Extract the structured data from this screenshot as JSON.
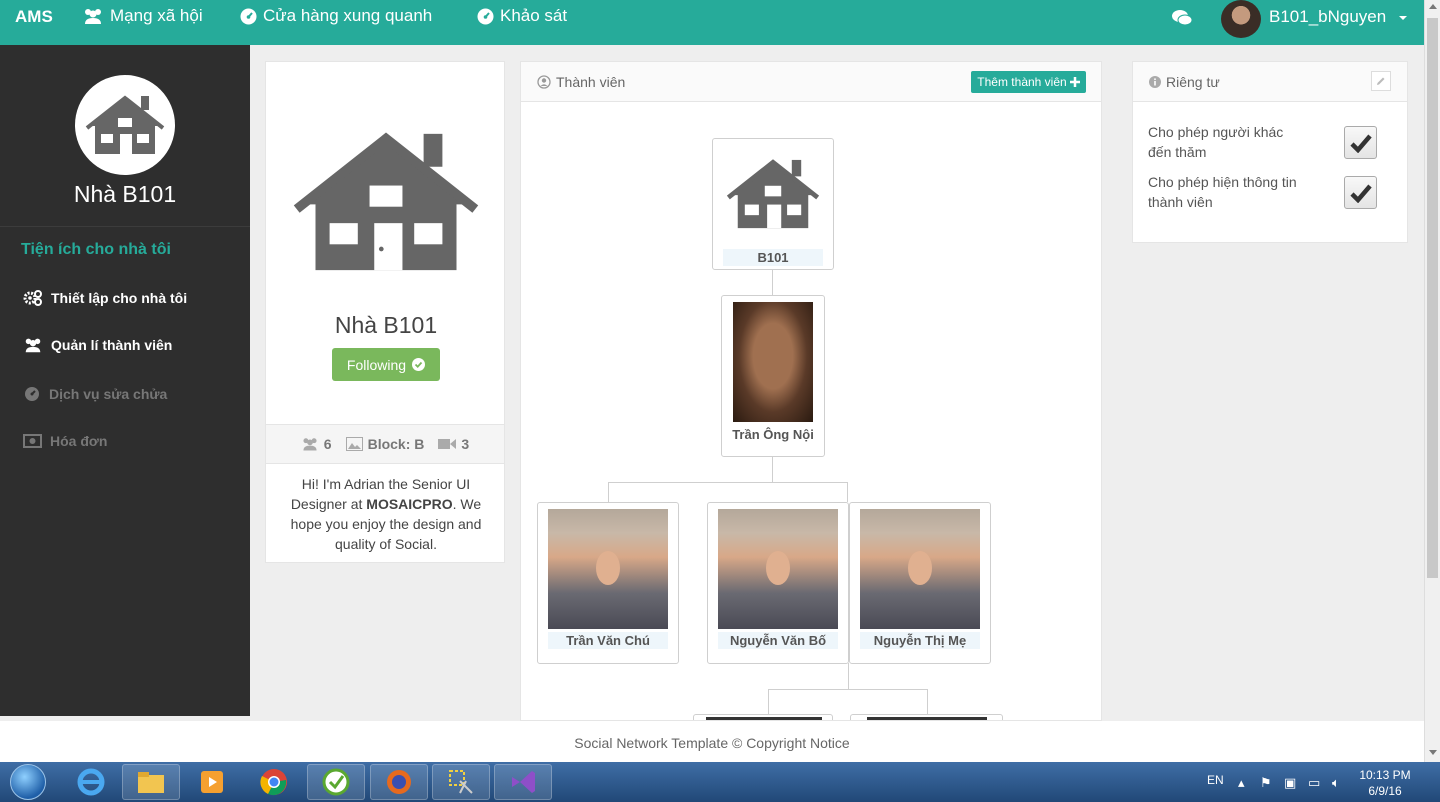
{
  "topnav": {
    "brand": "AMS",
    "items": [
      "Mạng xã hội",
      "Cửa hàng xung quanh",
      "Khảo sát"
    ],
    "username": "B101_bNguyen"
  },
  "sidebar": {
    "house_name": "Nhà B101",
    "section_title": "Tiện ích cho nhà tôi",
    "menu": [
      {
        "label": "Thiết lập cho nhà tôi",
        "icon": "gears-icon",
        "enabled": true
      },
      {
        "label": "Quản lí thành viên",
        "icon": "users-icon",
        "enabled": true
      },
      {
        "label": "Dịch vụ sửa chửa",
        "icon": "wrench-icon",
        "enabled": false
      },
      {
        "label": "Hóa đơn",
        "icon": "money-icon",
        "enabled": false
      }
    ]
  },
  "profile": {
    "name": "Nhà B101",
    "follow_label": "Following",
    "members_count": "6",
    "block": "Block: B",
    "video_count": "3",
    "bio_part1": "Hi! I'm Adrian the Senior UI Designer at ",
    "bio_brand": "MOSAICPRO",
    "bio_part2": ". We hope you enjoy the design and quality of Social."
  },
  "members": {
    "title": "Thành viên",
    "add_label": "Thêm thành viên",
    "tree": {
      "root": "B101",
      "grandparent": "Trần Ông Nội",
      "children": [
        "Trần Văn Chú",
        "Nguyễn Văn Bố",
        "Nguyễn Thị Mẹ"
      ]
    }
  },
  "privacy": {
    "title": "Riêng tư",
    "options": [
      {
        "label": "Cho phép người khác đến thăm",
        "checked": true
      },
      {
        "label": "Cho phép hiện thông tin thành viên",
        "checked": true
      }
    ]
  },
  "footer": {
    "text": "Social Network Template © Copyright Notice"
  },
  "taskbar": {
    "lang": "EN",
    "time": "10:13 PM",
    "date": "6/9/16"
  },
  "colors": {
    "accent": "#26ab9a",
    "sidebar_bg": "#2e2e2e",
    "follow_green": "#7ab85c"
  }
}
